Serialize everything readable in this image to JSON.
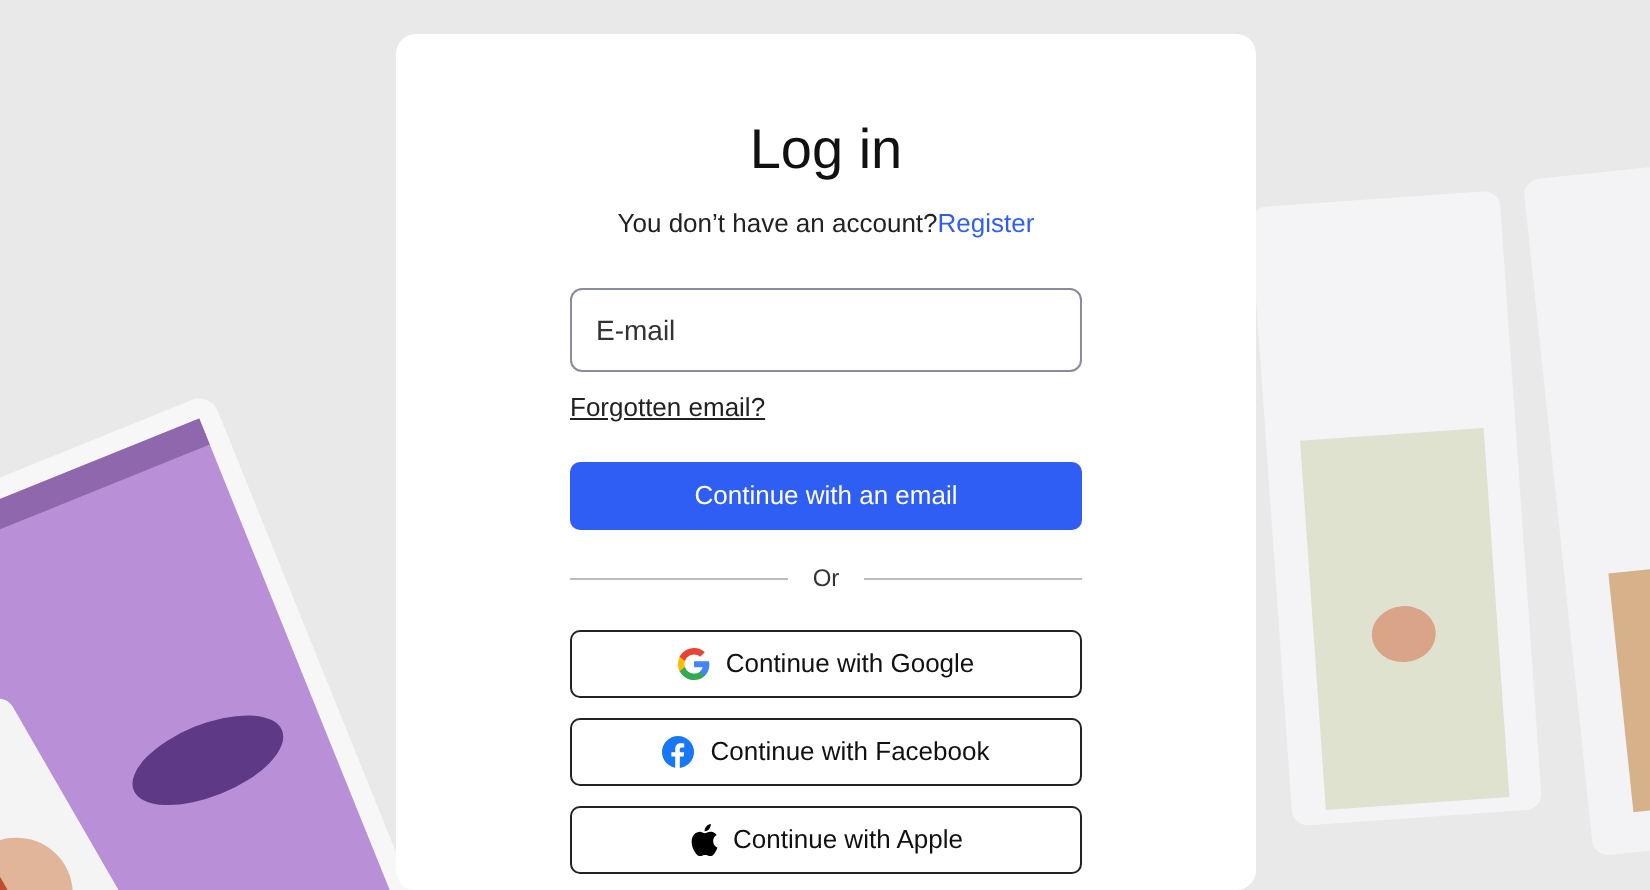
{
  "title": "Log in",
  "prompt": {
    "text": "You don’t have an account?",
    "link": "Register"
  },
  "email_field": {
    "placeholder": "E-mail"
  },
  "forgot_link": "Forgotten email?",
  "primary_button": "Continue with an email",
  "divider": "Or",
  "social_buttons": [
    {
      "kind": "google",
      "label": "Continue with Google"
    },
    {
      "kind": "facebook",
      "label": "Continue with Facebook"
    },
    {
      "kind": "apple",
      "label": "Continue with Apple"
    }
  ]
}
